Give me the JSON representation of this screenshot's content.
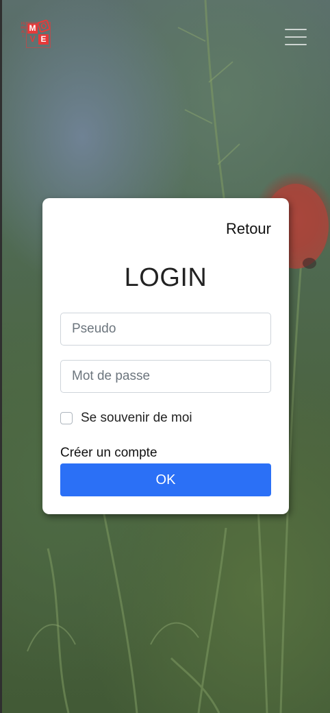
{
  "header": {
    "logo": {
      "side_text": "FERNALL",
      "letters": [
        "M",
        "O",
        "V",
        "E"
      ]
    },
    "menu_icon": "hamburger-menu-icon"
  },
  "login_modal": {
    "back_label": "Retour",
    "title": "LOGIN",
    "username_placeholder": "Pseudo",
    "password_placeholder": "Mot de passe",
    "remember_label": "Se souvenir de moi",
    "remember_checked": false,
    "create_account_label": "Créer un compte",
    "submit_label": "OK"
  },
  "colors": {
    "accent": "#2b70f6",
    "logo_red": "#e53a3a",
    "card_background": "#ffffff"
  }
}
